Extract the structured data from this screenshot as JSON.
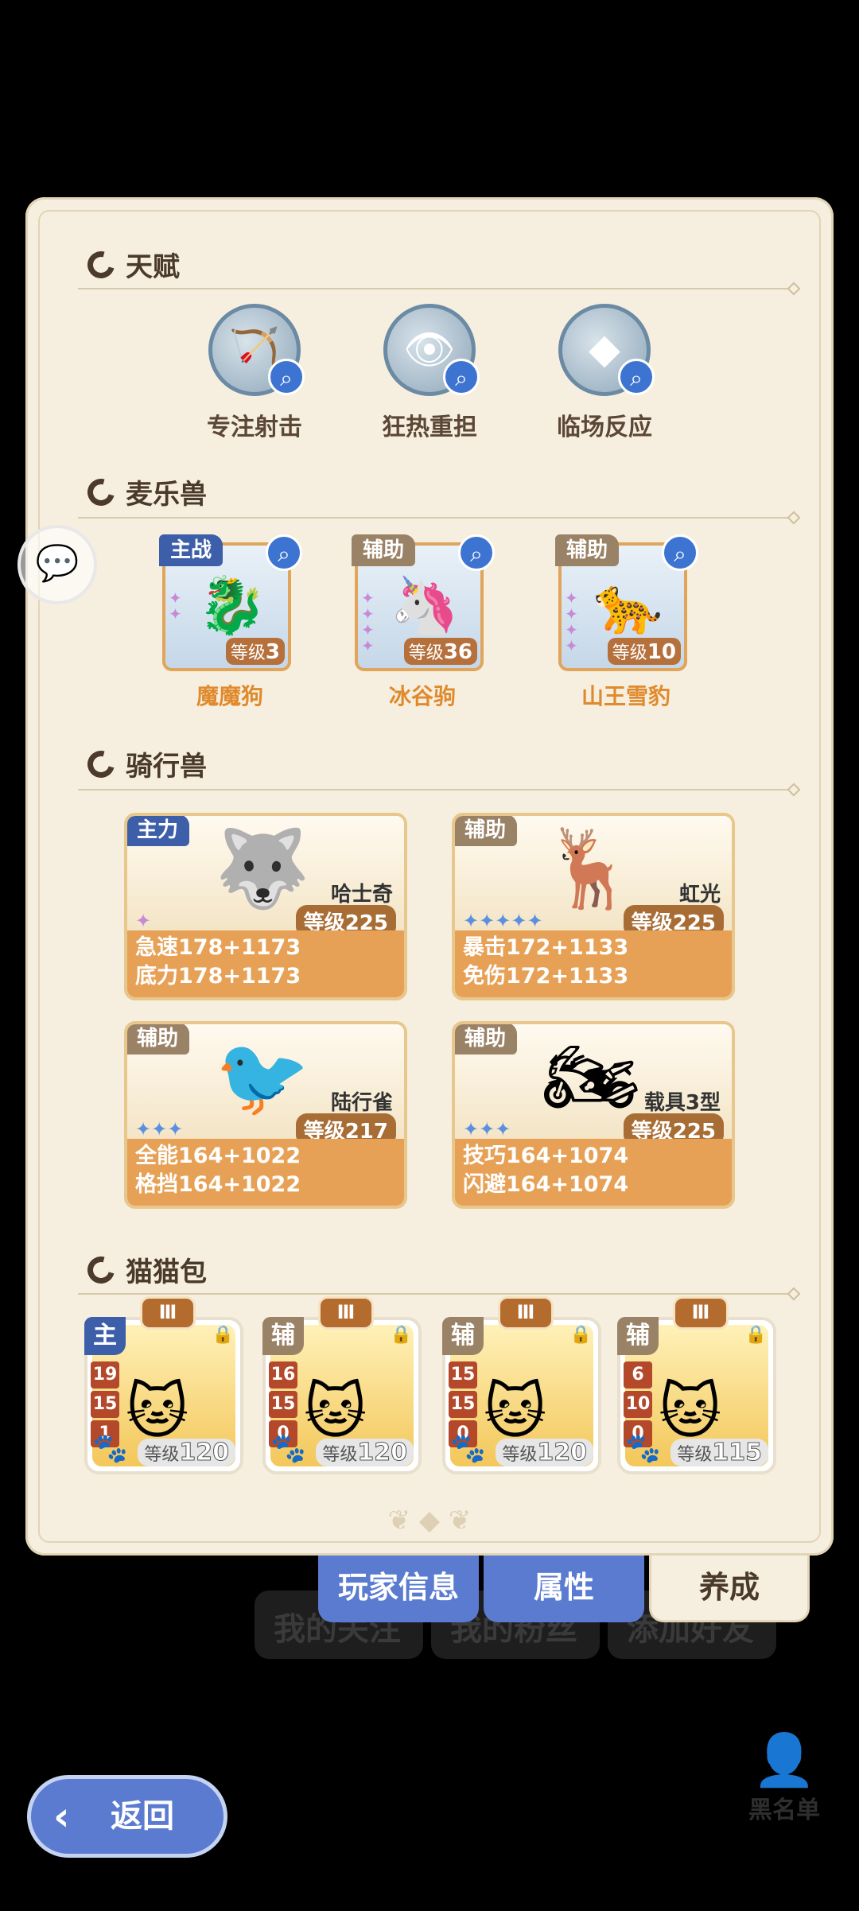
{
  "talents": {
    "title": "天赋",
    "items": [
      {
        "label": "专注射击",
        "icon": "bow-icon"
      },
      {
        "label": "狂热重担",
        "icon": "eye-icon"
      },
      {
        "label": "临场反应",
        "icon": "diamond-icon"
      }
    ]
  },
  "pets": {
    "title": "麦乐兽",
    "items": [
      {
        "tag": "主战",
        "name": "魔魔狗",
        "level_label": "等级",
        "level": "3"
      },
      {
        "tag": "辅助",
        "name": "冰谷驹",
        "level_label": "等级",
        "level": "36"
      },
      {
        "tag": "辅助",
        "name": "山王雪豹",
        "level_label": "等级",
        "level": "10"
      }
    ]
  },
  "mounts": {
    "title": "骑行兽",
    "items": [
      {
        "tag": "主力",
        "name": "哈士奇",
        "level": "等级225",
        "stat1": "急速178+1173",
        "stat2": "底力178+1173"
      },
      {
        "tag": "辅助",
        "name": "虹光",
        "level": "等级225",
        "stat1": "暴击172+1133",
        "stat2": "免伤172+1133"
      },
      {
        "tag": "辅助",
        "name": "陆行雀",
        "level": "等级217",
        "stat1": "全能164+1022",
        "stat2": "格挡164+1022"
      },
      {
        "tag": "辅助",
        "name": "载具3型",
        "level": "等级225",
        "stat1": "技巧164+1074",
        "stat2": "闪避164+1074"
      }
    ]
  },
  "bags": {
    "title": "猫猫包",
    "items": [
      {
        "tag": "主",
        "tier": "Ⅲ",
        "nums": [
          "19",
          "15",
          "1"
        ],
        "level_label": "等级",
        "level": "120"
      },
      {
        "tag": "辅",
        "tier": "Ⅲ",
        "nums": [
          "16",
          "15",
          "0"
        ],
        "level_label": "等级",
        "level": "120"
      },
      {
        "tag": "辅",
        "tier": "Ⅲ",
        "nums": [
          "15",
          "15",
          "0"
        ],
        "level_label": "等级",
        "level": "120"
      },
      {
        "tag": "辅",
        "tier": "Ⅲ",
        "nums": [
          "6",
          "10",
          "0"
        ],
        "level_label": "等级",
        "level": "115"
      }
    ]
  },
  "tabs": [
    {
      "label": "玩家信息",
      "active": false
    },
    {
      "label": "属性",
      "active": false
    },
    {
      "label": "养成",
      "active": true
    }
  ],
  "background": {
    "buttons": [
      "我的关注",
      "我的粉丝",
      "添加好友"
    ],
    "blacklist": "黑名单"
  },
  "back_label": "返回",
  "colors": {
    "tab_blue": "#5a7bd0",
    "tab_active": "#f6efdf",
    "accent_orange": "#e7a157"
  }
}
